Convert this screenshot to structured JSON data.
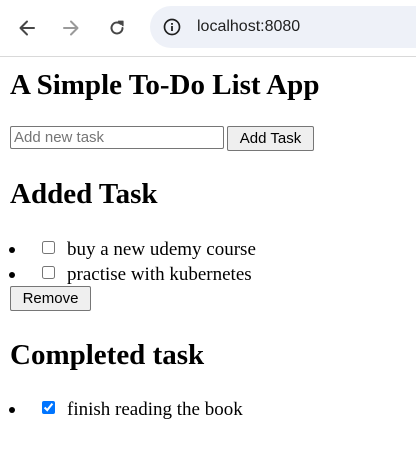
{
  "browser": {
    "url": "localhost:8080",
    "icons": [
      "back-arrow-icon",
      "forward-arrow-icon",
      "reload-icon",
      "site-info-icon"
    ]
  },
  "app": {
    "title": "A Simple To-Do List App",
    "input_placeholder": "Add new task",
    "input_value": "",
    "add_button_label": "Add Task",
    "added_section_title": "Added Task",
    "added_tasks": [
      {
        "label": "buy a new udemy course",
        "checked": false
      },
      {
        "label": "practise with kubernetes",
        "checked": false
      }
    ],
    "remove_button_label": "Remove",
    "completed_section_title": "Completed task",
    "completed_tasks": [
      {
        "label": "finish reading the book",
        "checked": true
      }
    ]
  },
  "colors": {
    "checkbox_accent": "#0075ff",
    "omnibox_bg": "#eef1f8"
  }
}
